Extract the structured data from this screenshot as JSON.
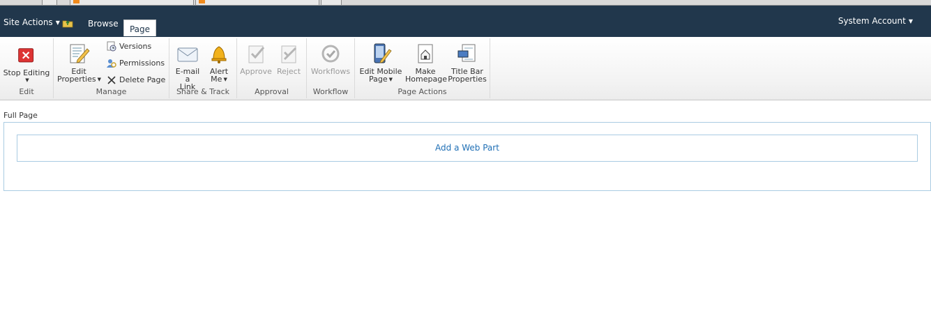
{
  "topbar": {
    "site_actions": "Site Actions",
    "tabs": [
      {
        "label": "Browse"
      },
      {
        "label": "Page"
      }
    ],
    "user": "System Account"
  },
  "ribbon": {
    "groups": {
      "edit": {
        "label": "Edit",
        "stop_editing": "Stop Editing"
      },
      "manage": {
        "label": "Manage",
        "edit_properties_1": "Edit",
        "edit_properties_2": "Properties",
        "versions": "Versions",
        "permissions": "Permissions",
        "delete_page": "Delete Page"
      },
      "share": {
        "label": "Share & Track",
        "email_1": "E-mail a",
        "email_2": "Link",
        "alert_1": "Alert",
        "alert_2": "Me"
      },
      "approval": {
        "label": "Approval",
        "approve": "Approve",
        "reject": "Reject"
      },
      "workflow": {
        "label": "Workflow",
        "workflows": "Workflows"
      },
      "page_actions": {
        "label": "Page Actions",
        "mobile_1": "Edit Mobile",
        "mobile_2": "Page",
        "home_1": "Make",
        "home_2": "Homepage",
        "title_1": "Title Bar",
        "title_2": "Properties"
      }
    }
  },
  "content": {
    "zone_title": "Full Page",
    "add_web_part": "Add a Web Part"
  },
  "colors": {
    "topbar": "#21374c",
    "link": "#1f6fb5",
    "zone_border": "#a9cbe2"
  }
}
